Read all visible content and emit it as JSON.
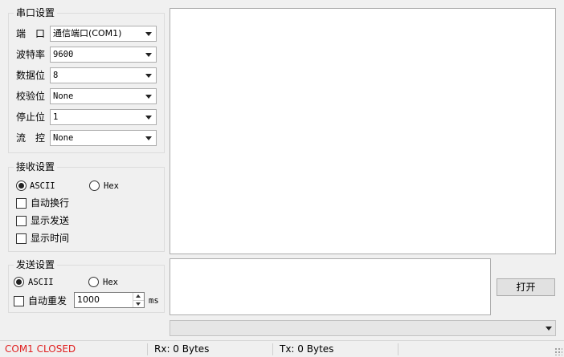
{
  "serial_settings": {
    "title": "串口设置",
    "fields": [
      {
        "label": "端　口",
        "value": "通信端口(COM1)"
      },
      {
        "label": "波特率",
        "value": "9600"
      },
      {
        "label": "数据位",
        "value": "8"
      },
      {
        "label": "校验位",
        "value": "None"
      },
      {
        "label": "停止位",
        "value": "1"
      },
      {
        "label": "流　控",
        "value": "None"
      }
    ]
  },
  "receive_settings": {
    "title": "接收设置",
    "radio_ascii": "ASCII",
    "radio_hex": "Hex",
    "selected": "ASCII",
    "checkboxes": [
      {
        "label": "自动换行",
        "checked": false
      },
      {
        "label": "显示发送",
        "checked": false
      },
      {
        "label": "显示时间",
        "checked": false
      }
    ]
  },
  "send_settings": {
    "title": "发送设置",
    "radio_ascii": "ASCII",
    "radio_hex": "Hex",
    "selected": "ASCII",
    "auto_resend_label": "自动重发",
    "auto_resend_checked": false,
    "interval_value": "1000",
    "interval_unit": "ms"
  },
  "send_panel": {
    "open_button_label": "打开",
    "history_value": ""
  },
  "status_bar": {
    "port_status": "COM1 CLOSED",
    "port_status_color": "#e02020",
    "rx": "Rx: 0 Bytes",
    "tx": "Tx: 0 Bytes"
  }
}
